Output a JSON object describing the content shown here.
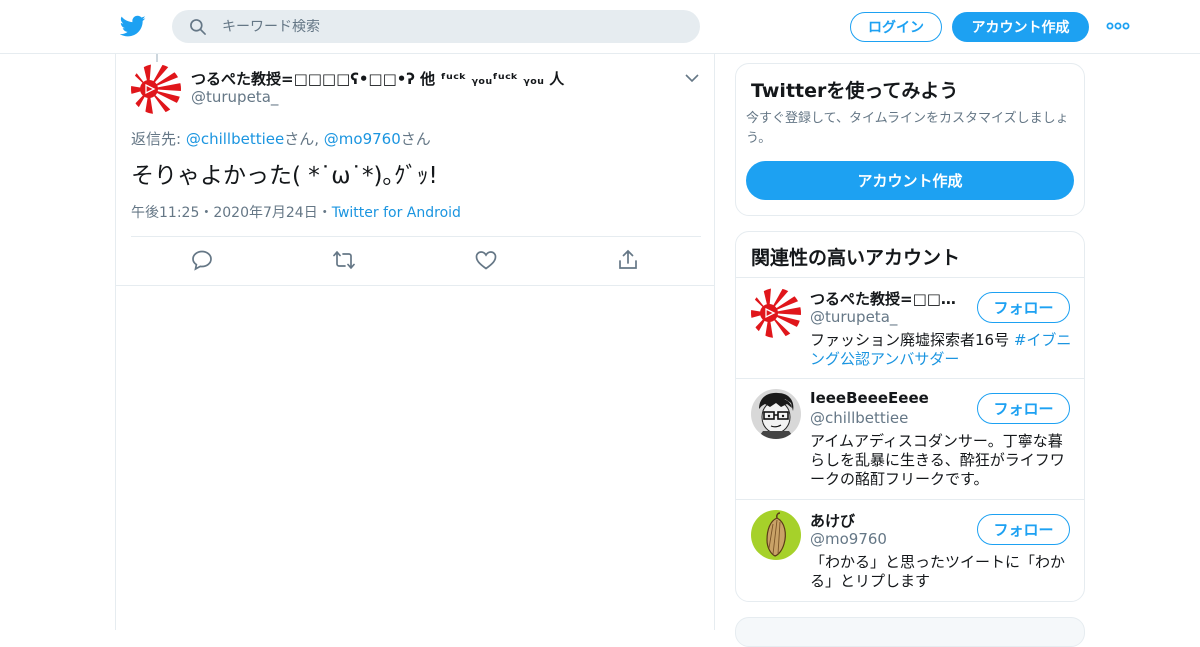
{
  "header": {
    "logo_icon": "twitter-bird-icon",
    "search": {
      "placeholder": "キーワード検索",
      "value": ""
    },
    "login_label": "ログイン",
    "signup_label": "アカウント作成",
    "more_icon": "more-dots-icon"
  },
  "tweet": {
    "author_name": "つるぺた教授=□□□□ʕ•□□•ʔ 他 ᶠᵘᶜᵏ ᵧₒᵤᶠᵘᶜᵏ ᵧₒᵤ 人",
    "author_handle": "@turupeta_",
    "reply_prefix": "返信先: ",
    "reply_to_1": "@chillbettiee",
    "reply_sep_1": "さん, ",
    "reply_to_2": "@mo9760",
    "reply_sep_2": "さん",
    "text": "そりゃよかった( *˙ω˙*)｡ｸﾞｯ!",
    "time": "午後11:25",
    "dot": "・",
    "date": "2020年7月24日",
    "source": "Twitter for Android",
    "actions": [
      "reply-icon",
      "retweet-icon",
      "like-icon",
      "share-icon"
    ]
  },
  "signup_card": {
    "title": "Twitterを使ってみよう",
    "description": "今すぐ登録して、タイムラインをカスタマイズしましょう。",
    "button_label": "アカウント作成"
  },
  "related": {
    "title": "関連性の高いアカウント",
    "follow_label": "フォロー",
    "accounts": [
      {
        "name": "つるぺた教授=□□□□□□□□",
        "handle": "@turupeta_",
        "bio": "ファッション廃墟探索者16号 ",
        "bio_link": "#イブニング公認アンバサダー"
      },
      {
        "name": "IeeeBeeeEeee",
        "handle": "@chillbettiee",
        "bio": "アイムアディスコダンサー。丁寧な暮らしを乱暴に生きる、酔狂がライフワークの酩酊フリークです。"
      },
      {
        "name": "あけび",
        "handle": "@mo9760",
        "bio": "「わかる」と思ったツイートに「わかる」とリプします"
      }
    ]
  },
  "colors": {
    "accent": "#1da1f2",
    "link": "#1b95e0",
    "secondary_text": "#657786",
    "border": "#e6ecf0"
  }
}
